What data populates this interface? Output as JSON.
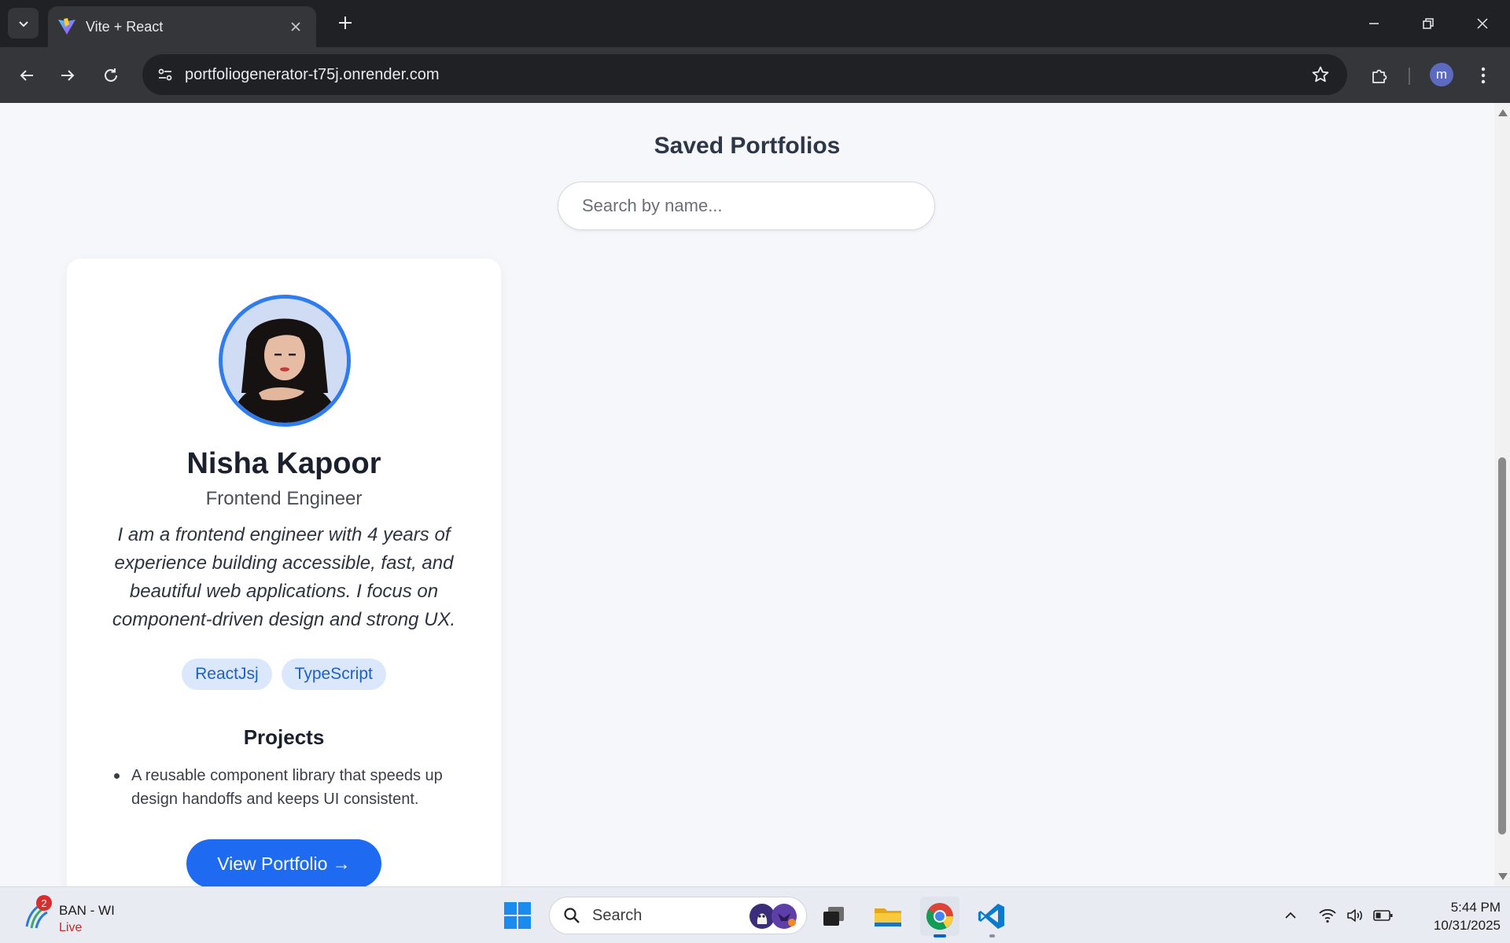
{
  "browser": {
    "tab_title": "Vite + React",
    "url": "portfoliogenerator-t75j.onrender.com",
    "profile_initial": "m"
  },
  "page": {
    "heading": "Saved Portfolios",
    "search_placeholder": "Search by name..."
  },
  "portfolio": {
    "name": "Nisha Kapoor",
    "role": "Frontend Engineer",
    "bio": "I am a frontend engineer with 4 years of experience building accessible, fast, and beautiful web applications. I focus on component-driven design and strong UX.",
    "skills": [
      "ReactJsj",
      "TypeScript"
    ],
    "projects_heading": "Projects",
    "projects": [
      "A reusable component library that speeds up design handoffs and keeps UI consistent."
    ],
    "view_button": "View Portfolio →"
  },
  "taskbar": {
    "widget_badge": "2",
    "widget_title": "BAN - WI",
    "widget_subtitle": "Live",
    "search_label": "Search",
    "time": "5:44 PM",
    "date": "10/31/2025"
  },
  "colors": {
    "accent": "#1e6bf2",
    "avatar_ring": "#2f7bf0",
    "tag_bg": "#dbe8fc",
    "tag_text": "#1f5fc8",
    "page_bg": "#f5f7fa",
    "live_red": "#c62828"
  },
  "icons": {
    "tab_search": "chevron-down-icon",
    "favicon": "vite-logo-icon",
    "back": "arrow-left-icon",
    "forward": "arrow-right-icon",
    "reload": "reload-icon",
    "site_info": "tune-icon",
    "bookmark": "star-icon",
    "extensions": "puzzle-icon",
    "menu": "kebab-menu-icon"
  }
}
